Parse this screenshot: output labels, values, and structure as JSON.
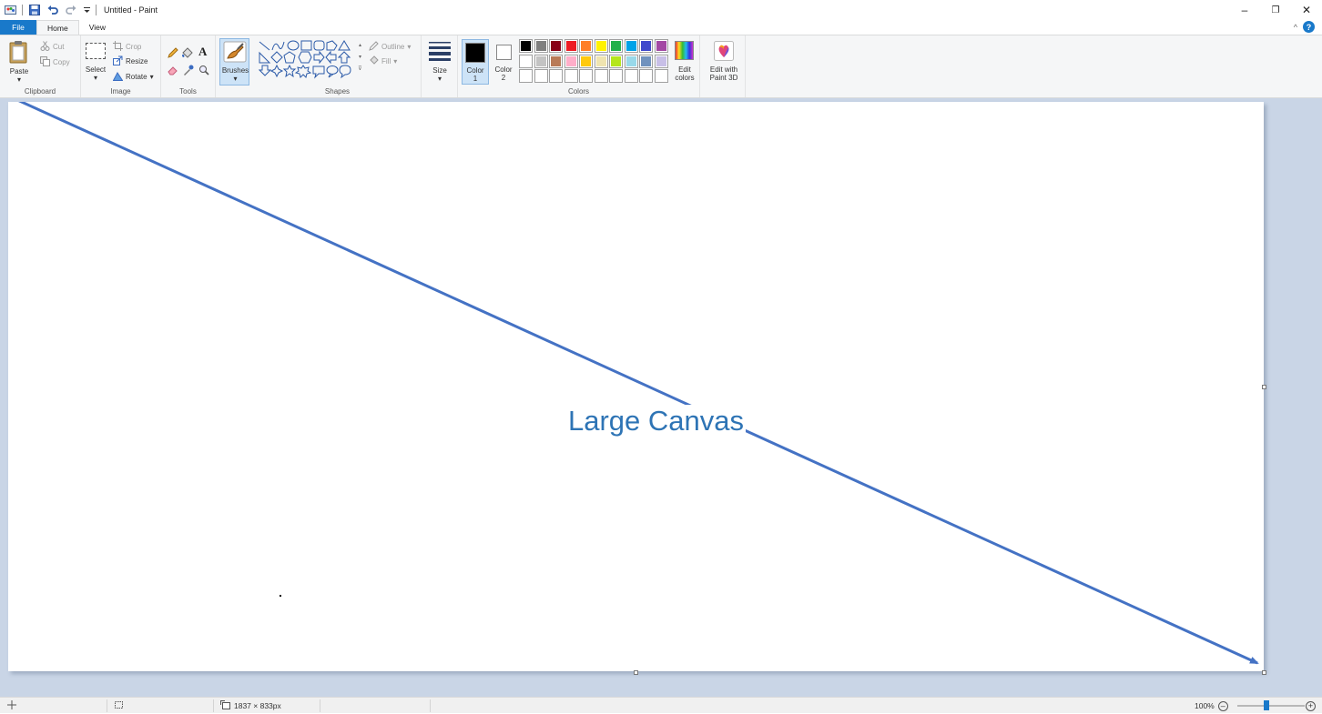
{
  "window": {
    "title": "Untitled - Paint",
    "minimize": "–",
    "restore": "❐",
    "close": "✕"
  },
  "tabs": {
    "file": "File",
    "home": "Home",
    "view": "View",
    "collapse": "^",
    "help": "?"
  },
  "ribbon": {
    "clipboard": {
      "label": "Clipboard",
      "paste": "Paste",
      "cut": "Cut",
      "copy": "Copy"
    },
    "image": {
      "label": "Image",
      "select": "Select",
      "crop": "Crop",
      "resize": "Resize",
      "rotate": "Rotate"
    },
    "tools": {
      "label": "Tools"
    },
    "brushes": {
      "label": "Brushes"
    },
    "shapes": {
      "label": "Shapes",
      "outline": "Outline",
      "fill": "Fill"
    },
    "size": {
      "label": "Size"
    },
    "colors": {
      "label": "Colors",
      "color1_line1": "Color",
      "color1_line2": "1",
      "color2_line1": "Color",
      "color2_line2": "2",
      "edit_line1": "Edit",
      "edit_line2": "colors",
      "palette_row1": [
        "#000000",
        "#7f7f7f",
        "#880015",
        "#ed1c24",
        "#ff7f27",
        "#fff200",
        "#22b14c",
        "#00a2e8",
        "#3f48cc",
        "#a349a4"
      ],
      "palette_row2": [
        "#ffffff",
        "#c3c3c3",
        "#b97a57",
        "#ffaec9",
        "#ffc90e",
        "#efe4b0",
        "#b5e61d",
        "#99d9ea",
        "#7092be",
        "#c8bfe7"
      ],
      "color1_value": "#000000",
      "color2_value": "#ffffff"
    },
    "paint3d": {
      "line1": "Edit with",
      "line2": "Paint 3D"
    }
  },
  "canvas": {
    "text": "Large Canvas",
    "arrow_color": "#4472c4"
  },
  "status": {
    "dimensions": "1837 × 833px",
    "zoom": "100%",
    "zoom_out": "–",
    "zoom_in": "+"
  }
}
